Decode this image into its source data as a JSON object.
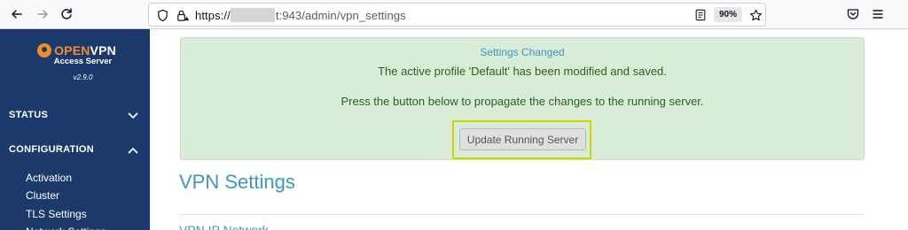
{
  "browser": {
    "url_prefix": "https://",
    "url_suffix": "t:943/admin/vpn_settings",
    "zoom": "90%"
  },
  "sidebar": {
    "logo_open": "OPEN",
    "logo_vpn": "VPN",
    "logo_subtitle": "Access Server",
    "version": "v2.9.0",
    "sections": [
      {
        "label": "STATUS",
        "expanded": false
      },
      {
        "label": "CONFIGURATION",
        "expanded": true
      }
    ],
    "config_items": [
      "Activation",
      "Cluster",
      "TLS Settings",
      "Network Settings"
    ]
  },
  "alert": {
    "title": "Settings Changed",
    "message": "The active profile 'Default' has been modified and saved.",
    "instruction": "Press the button below to propagate the changes to the running server.",
    "button_label": "Update Running Server"
  },
  "main": {
    "page_title": "VPN Settings",
    "next_section_title": "VPN IP Network"
  },
  "colors": {
    "sidebar_bg": "#1b3a6b",
    "brand_orange": "#f28c28",
    "alert_bg": "#d8ecd8",
    "accent_blue": "#3c96c8",
    "focus_outline": "#d2d600"
  }
}
